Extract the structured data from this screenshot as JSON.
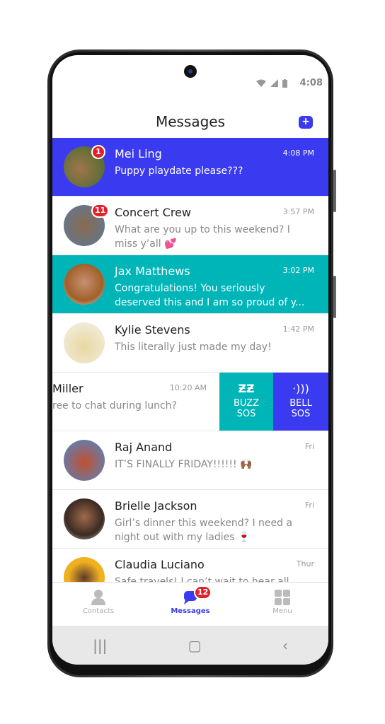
{
  "status": {
    "time": "4:08"
  },
  "header": {
    "title": "Messages"
  },
  "colors": {
    "accent": "#3a3af0",
    "teal": "#00b5b8",
    "badge": "#e0202a"
  },
  "conversations": [
    {
      "name": "Mei Ling",
      "time": "4:08 PM",
      "message": "Puppy playdate please???",
      "badge": "1",
      "highlight": "blue"
    },
    {
      "name": "Concert Crew",
      "time": "3:57 PM",
      "message": "What are you up to this weekend? I miss y’all 💕",
      "badge": "11"
    },
    {
      "name": "Jax Matthews",
      "time": "3:02 PM",
      "message": "Congratulations! You seriously deserved this and I am so proud of y...",
      "highlight": "teal"
    },
    {
      "name": "Kylie Stevens",
      "time": "1:42 PM",
      "message": "This literally just made my day!"
    },
    {
      "name": "Miller",
      "time": "10:20 AM",
      "message": "ree to chat during lunch?",
      "swiped": true
    },
    {
      "name": "Raj Anand",
      "time": "Fri",
      "message": "IT’S FINALLY FRIDAY!!!!!! 🙌🏾"
    },
    {
      "name": "Brielle Jackson",
      "time": "Fri",
      "message": "Girl’s dinner this weekend? I need a night out with my ladies 🍷"
    },
    {
      "name": "Claudia Luciano",
      "time": "Thur",
      "message": "Safe travels! I can’t wait to hear all"
    }
  ],
  "swipe_actions": [
    {
      "label1": "BUZZ",
      "label2": "SOS",
      "icon": "buzz-icon"
    },
    {
      "label1": "BELL",
      "label2": "SOS",
      "icon": "bell-ring-icon"
    }
  ],
  "tabs": [
    {
      "label": "Contacts",
      "icon": "person-icon"
    },
    {
      "label": "Messages",
      "icon": "chat-icon",
      "badge": "12",
      "active": true
    },
    {
      "label": "Menu",
      "icon": "grid-icon"
    }
  ],
  "navbar": {
    "recent": "|||",
    "home": "▢",
    "back": "‹"
  }
}
